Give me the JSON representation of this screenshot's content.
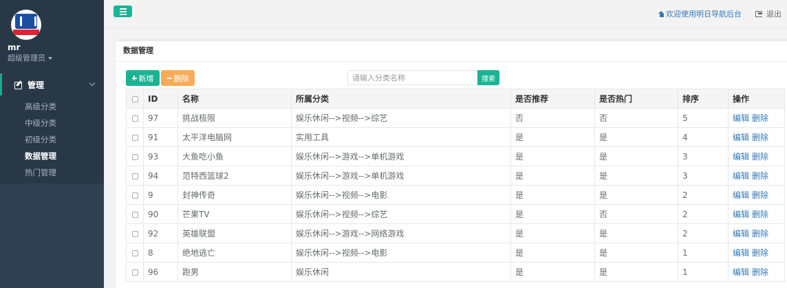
{
  "sidebar": {
    "user_name": "mr",
    "user_role": "超级管理员",
    "menu_title": "管理",
    "menu_items": [
      {
        "label": "高级分类",
        "active": false
      },
      {
        "label": "中级分类",
        "active": false
      },
      {
        "label": "初级分类",
        "active": false
      },
      {
        "label": "数据管理",
        "active": true
      },
      {
        "label": "热门管理",
        "active": false
      }
    ]
  },
  "header": {
    "welcome": "欢迎使用明日导航后台",
    "logout": "退出"
  },
  "panel": {
    "title": "数据管理",
    "add_label": "新增",
    "delete_label": "删除",
    "search_placeholder": "请输入分类名称",
    "search_label": "搜索"
  },
  "table": {
    "headers": [
      "ID",
      "名称",
      "所属分类",
      "是否推荐",
      "是否热门",
      "排序",
      "操作"
    ],
    "edit_label": "编辑",
    "delete_label": "删除",
    "rows": [
      {
        "id": "97",
        "name": "挑战极限",
        "category": "娱乐休闲-->视频-->综艺",
        "recommend": "否",
        "hot": "否",
        "order": "5"
      },
      {
        "id": "91",
        "name": "太平洋电脑网",
        "category": "实用工具",
        "recommend": "是",
        "hot": "是",
        "order": "4"
      },
      {
        "id": "93",
        "name": "大鱼吃小鱼",
        "category": "娱乐休闲-->游戏-->单机游戏",
        "recommend": "是",
        "hot": "是",
        "order": "3"
      },
      {
        "id": "94",
        "name": "范特西篮球2",
        "category": "娱乐休闲-->游戏-->单机游戏",
        "recommend": "是",
        "hot": "是",
        "order": "3"
      },
      {
        "id": "9",
        "name": "封神传奇",
        "category": "娱乐休闲-->视频-->电影",
        "recommend": "是",
        "hot": "是",
        "order": "2"
      },
      {
        "id": "90",
        "name": "芒果TV",
        "category": "娱乐休闲-->视频-->综艺",
        "recommend": "是",
        "hot": "否",
        "order": "2"
      },
      {
        "id": "92",
        "name": "英雄联盟",
        "category": "娱乐休闲-->游戏-->网络游戏",
        "recommend": "是",
        "hot": "是",
        "order": "2"
      },
      {
        "id": "8",
        "name": "绝地逃亡",
        "category": "娱乐休闲-->视频-->电影",
        "recommend": "是",
        "hot": "是",
        "order": "1"
      },
      {
        "id": "96",
        "name": "跑男",
        "category": "娱乐休闲",
        "recommend": "是",
        "hot": "是",
        "order": "1"
      }
    ]
  },
  "colors": {
    "sidebar_bg": "#2f4050",
    "primary": "#1ab394",
    "warning": "#f8ac59",
    "link": "#337ab7"
  }
}
